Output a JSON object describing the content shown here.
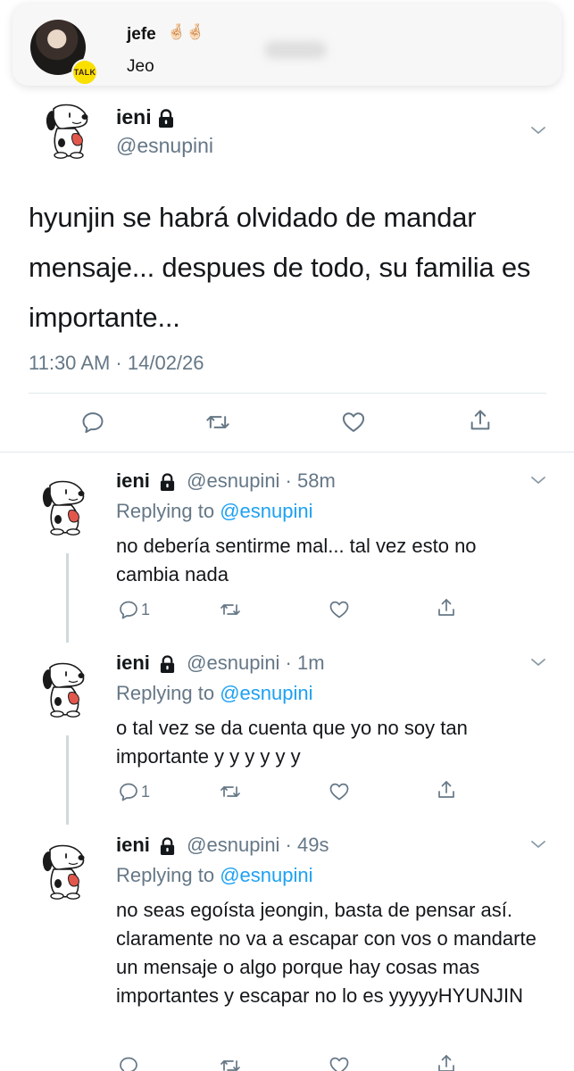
{
  "notification": {
    "sender": "jefe",
    "sender_emoji": "🤞🏻🤞🏻",
    "message": "Jeo",
    "badge": "TALK"
  },
  "main_tweet": {
    "name": "ieni",
    "handle": "@esnupini",
    "text": "hyunjin se habrá olvidado de mandar mensaje... despues de todo, su familia es importante...",
    "timestamp": "11:30 AM · 14/02/26",
    "actions": [
      "reply-icon",
      "retweet-icon",
      "like-icon",
      "share-icon"
    ]
  },
  "replies": [
    {
      "name": "ieni",
      "handle_time": "@esnupini · 58m",
      "replying_prefix": "Replying to ",
      "replying_to": "@esnupini",
      "text": "no debería sentirme mal... tal vez esto no cambia nada",
      "reply_count": "1"
    },
    {
      "name": "ieni",
      "handle_time": "@esnupini · 1m",
      "replying_prefix": "Replying to ",
      "replying_to": "@esnupini",
      "text": "o tal vez se da cuenta que yo no soy tan importante  y y y y y y",
      "reply_count": "1"
    },
    {
      "name": "ieni",
      "handle_time": "@esnupini · 49s",
      "replying_prefix": "Replying to ",
      "replying_to": "@esnupini",
      "text": "no seas egoísta jeongin, basta de pensar así. claramente no va a escapar con vos o mandarte un mensaje o algo porque hay cosas mas importantes y escapar no lo es yyyyyHYUNJIN",
      "reply_count": ""
    }
  ],
  "colors": {
    "text": "#14171a",
    "secondary": "#657786",
    "link": "#1da1f2",
    "divider": "#e1e8ed",
    "kakao": "#f9e000"
  }
}
